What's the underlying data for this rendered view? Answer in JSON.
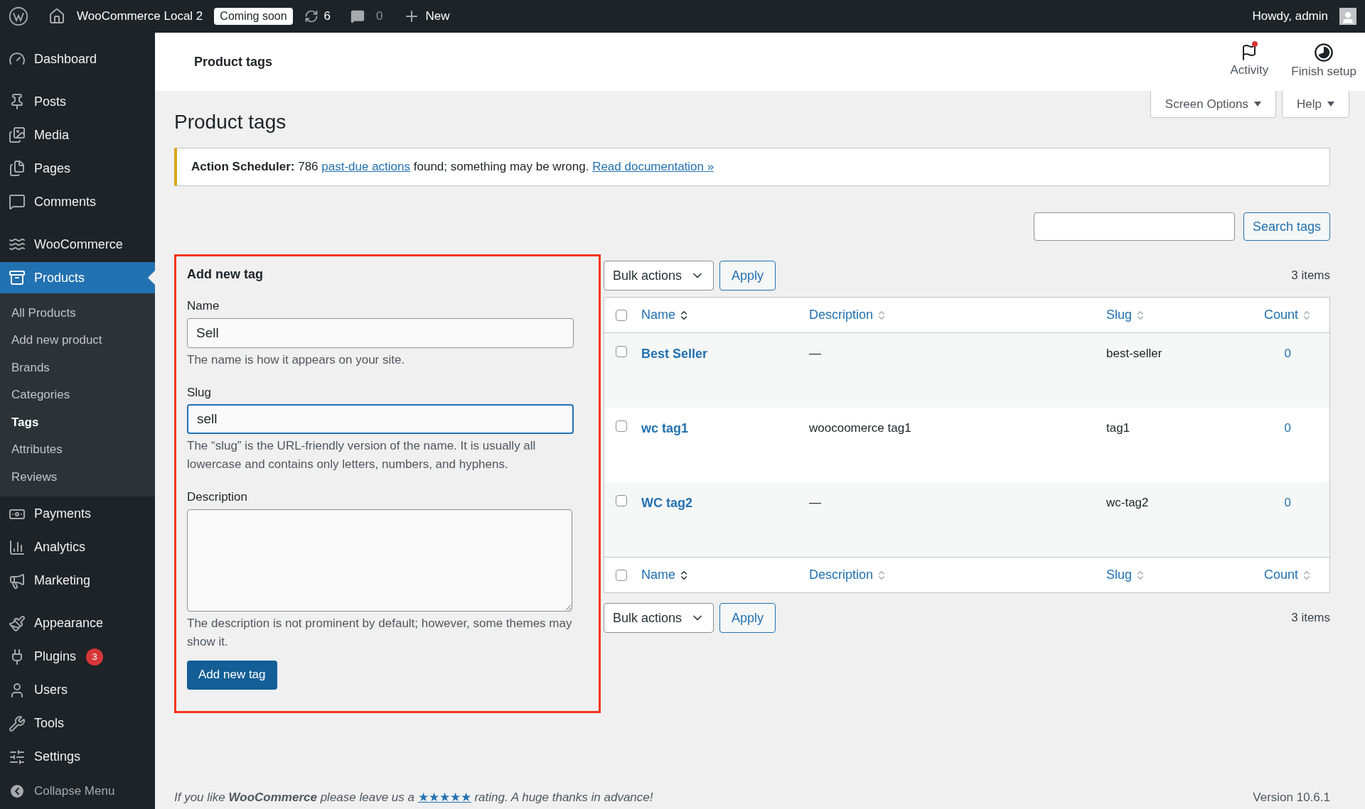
{
  "admin_bar": {
    "site": "WooCommerce Local 2",
    "badge": "Coming soon",
    "updates": "6",
    "comments": "0",
    "new": "New",
    "greeting": "Howdy, admin"
  },
  "sidebar": {
    "items": [
      {
        "label": "Dashboard",
        "selected": false
      },
      {
        "label": "Posts",
        "selected": false
      },
      {
        "label": "Media",
        "selected": false
      },
      {
        "label": "Pages",
        "selected": false
      },
      {
        "label": "Comments",
        "selected": false
      },
      {
        "label": "WooCommerce",
        "selected": false
      },
      {
        "label": "Products",
        "selected": true,
        "children": [
          {
            "label": "All Products",
            "selected": false
          },
          {
            "label": "Add new product",
            "selected": false
          },
          {
            "label": "Brands",
            "selected": false
          },
          {
            "label": "Categories",
            "selected": false
          },
          {
            "label": "Tags",
            "selected": true
          },
          {
            "label": "Attributes",
            "selected": false
          },
          {
            "label": "Reviews",
            "selected": false
          }
        ]
      },
      {
        "label": "Payments",
        "selected": false
      },
      {
        "label": "Analytics",
        "selected": false
      },
      {
        "label": "Marketing",
        "selected": false
      },
      {
        "label": "Appearance",
        "selected": false
      },
      {
        "label": "Plugins",
        "selected": false,
        "badge": "3"
      },
      {
        "label": "Users",
        "selected": false
      },
      {
        "label": "Tools",
        "selected": false
      },
      {
        "label": "Settings",
        "selected": false
      }
    ],
    "collapse": "Collapse Menu"
  },
  "header": {
    "title": "Product tags",
    "activity": "Activity",
    "finish_setup": "Finish setup"
  },
  "screen_options": "Screen Options",
  "help": "Help",
  "page_title": "Product tags",
  "notice": {
    "segments": [
      {
        "kind": "bold",
        "text": "Action Scheduler:"
      },
      {
        "kind": "plain",
        "text": " 786 "
      },
      {
        "kind": "link",
        "text": "past-due actions"
      },
      {
        "kind": "plain",
        "text": " found; something may be wrong. "
      },
      {
        "kind": "link",
        "text": "Read documentation »"
      }
    ]
  },
  "search": {
    "button": "Search tags"
  },
  "add_form": {
    "title": "Add new tag",
    "fields": [
      {
        "kind": "input",
        "label": "Name",
        "value": "Sell",
        "focused": false,
        "help": "The name is how it appears on your site."
      },
      {
        "kind": "input",
        "label": "Slug",
        "value": "sell",
        "focused": true,
        "help": "The “slug” is the URL-friendly version of the name. It is usually all lowercase and contains only letters, numbers, and hyphens."
      },
      {
        "kind": "textarea",
        "label": "Description",
        "focused": false,
        "help": "The description is not prominent by default; however, some themes may show it."
      }
    ],
    "submit": "Add new tag"
  },
  "table": {
    "top": {
      "bulk_actions": "Bulk actions",
      "apply": "Apply",
      "count": "3 items"
    },
    "header_checked": false,
    "footer_checked": false,
    "columns": [
      {
        "label": "Name",
        "sorted": true
      },
      {
        "label": "Description",
        "sorted": false
      },
      {
        "label": "Slug",
        "sorted": false
      },
      {
        "label": "Count",
        "sorted": false
      }
    ],
    "rows": [
      {
        "checked": false,
        "name": "Best Seller",
        "description": "—",
        "slug": "best-seller",
        "count": "0"
      },
      {
        "checked": false,
        "name": "wc tag1",
        "description": "woocoomerce tag1",
        "slug": "tag1",
        "count": "0"
      },
      {
        "checked": false,
        "name": "WC tag2",
        "description": "—",
        "slug": "wc-tag2",
        "count": "0"
      }
    ],
    "footer_columns": [
      {
        "label": "Name",
        "sorted": true
      },
      {
        "label": "Description",
        "sorted": false
      },
      {
        "label": "Slug",
        "sorted": false
      },
      {
        "label": "Count",
        "sorted": false
      }
    ],
    "bottom": {
      "bulk_actions": "Bulk actions",
      "apply": "Apply",
      "count": "3 items"
    }
  },
  "footer": {
    "before": "If you like **WooCommerce** please leave us a ",
    "stars_link": "★★★★★",
    "after": " rating. A huge thanks in advance!",
    "version": "Version 10.6.1"
  }
}
